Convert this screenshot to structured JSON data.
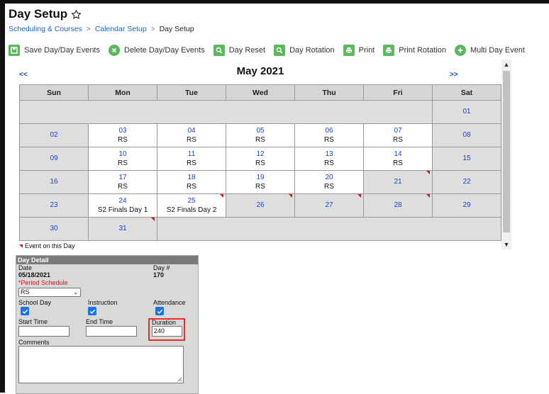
{
  "header": {
    "title": "Day Setup",
    "breadcrumb": [
      "Scheduling & Courses",
      "Calendar Setup",
      "Day Setup"
    ]
  },
  "toolbar": {
    "buttons": [
      {
        "label": "Save Day/Day Events",
        "icon": "save-icon"
      },
      {
        "label": "Delete Day/Day Events",
        "icon": "delete-icon"
      },
      {
        "label": "Day Reset",
        "icon": "search-icon"
      },
      {
        "label": "Day Rotation",
        "icon": "search-icon"
      },
      {
        "label": "Print",
        "icon": "print-icon"
      },
      {
        "label": "Print Rotation",
        "icon": "print-icon"
      },
      {
        "label": "Multi Day Event",
        "icon": "plus-icon"
      }
    ],
    "icon_color": "#5cb85c"
  },
  "calendar": {
    "prev": "<<",
    "next": ">>",
    "month": "May 2021",
    "weekdays": [
      "Sun",
      "Mon",
      "Tue",
      "Wed",
      "Thu",
      "Fri",
      "Sat"
    ],
    "weeks": [
      [
        {
          "day": ""
        },
        {
          "day": ""
        },
        {
          "day": ""
        },
        {
          "day": ""
        },
        {
          "day": ""
        },
        {
          "day": ""
        },
        {
          "day": "01"
        }
      ],
      [
        {
          "day": "02"
        },
        {
          "day": "03",
          "sched": "RS"
        },
        {
          "day": "04",
          "sched": "RS"
        },
        {
          "day": "05",
          "sched": "RS"
        },
        {
          "day": "06",
          "sched": "RS"
        },
        {
          "day": "07",
          "sched": "RS"
        },
        {
          "day": "08"
        }
      ],
      [
        {
          "day": "09"
        },
        {
          "day": "10",
          "sched": "RS"
        },
        {
          "day": "11",
          "sched": "RS"
        },
        {
          "day": "12",
          "sched": "RS"
        },
        {
          "day": "13",
          "sched": "RS"
        },
        {
          "day": "14",
          "sched": "RS"
        },
        {
          "day": "15"
        }
      ],
      [
        {
          "day": "16"
        },
        {
          "day": "17",
          "sched": "RS"
        },
        {
          "day": "18",
          "sched": "RS"
        },
        {
          "day": "19",
          "sched": "RS"
        },
        {
          "day": "20",
          "sched": "RS"
        },
        {
          "day": "21",
          "flag": true
        },
        {
          "day": "22"
        }
      ],
      [
        {
          "day": "23"
        },
        {
          "day": "24",
          "sched": "S2 Finals Day 1"
        },
        {
          "day": "25",
          "sched": "S2 Finals Day 2",
          "flag": true
        },
        {
          "day": "26",
          "flag": true
        },
        {
          "day": "27",
          "flag": true
        },
        {
          "day": "28",
          "flag": true
        },
        {
          "day": "29"
        }
      ],
      [
        {
          "day": "30"
        },
        {
          "day": "31",
          "flag": true
        }
      ]
    ],
    "event_flag_color": "#d9141b"
  },
  "legend": {
    "label": "Event on this Day"
  },
  "detail": {
    "header": "Day Detail",
    "date_label": "Date",
    "date_value": "05/18/2021",
    "daynum_label": "Day #",
    "daynum_value": "170",
    "period_label": "*Period Schedule",
    "period_value": "RS",
    "school_day_label": "School Day",
    "instruction_label": "Instruction",
    "attendance_label": "Attendance",
    "start_label": "Start Time",
    "end_label": "End Time",
    "duration_label": "Duration",
    "duration_value": "240",
    "comments_label": "Comments"
  }
}
